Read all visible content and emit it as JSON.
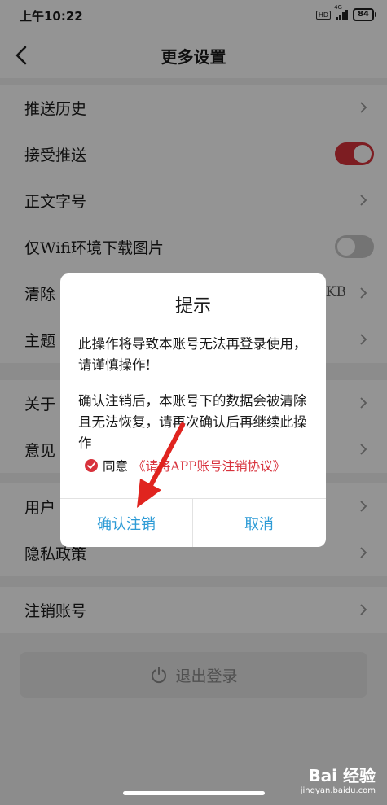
{
  "status_bar": {
    "time": "上午10:22",
    "hd": "HD",
    "network": "4G",
    "battery": "84"
  },
  "nav": {
    "title": "更多设置",
    "back_icon": "chevron-left-icon"
  },
  "settings": {
    "group1": [
      {
        "label": "推送历史",
        "type": "chevron"
      },
      {
        "label": "接受推送",
        "type": "toggle",
        "on": true
      },
      {
        "label": "正文字号",
        "type": "chevron"
      },
      {
        "label": "仅Wifi环境下载图片",
        "type": "toggle",
        "on": false
      },
      {
        "label": "清除",
        "type": "chevron",
        "value": "KB"
      },
      {
        "label": "主题",
        "type": "chevron"
      }
    ],
    "group2": [
      {
        "label": "关于",
        "type": "chevron"
      },
      {
        "label": "意见",
        "type": "chevron"
      }
    ],
    "group3": [
      {
        "label": "用户",
        "type": "chevron"
      },
      {
        "label": "隐私政策",
        "type": "chevron"
      }
    ],
    "group4": [
      {
        "label": "注销账号",
        "type": "chevron"
      }
    ],
    "logout": "退出登录"
  },
  "dialog": {
    "title": "提示",
    "message1": "此操作将导致本账号无法再登录使用，请谨慎操作!",
    "message2": "确认注销后，本账号下的数据会被清除且无法恢复，请再次确认后再继续此操作",
    "agree_prefix": "同意",
    "agree_link": "《请将APP账号注销协议》",
    "confirm": "确认注销",
    "cancel": "取消"
  },
  "watermark": {
    "logo": "Bai 经验",
    "url": "jingyan.baidu.com"
  },
  "colors": {
    "accent": "#d8323c",
    "button_blue": "#2d9bd6"
  }
}
